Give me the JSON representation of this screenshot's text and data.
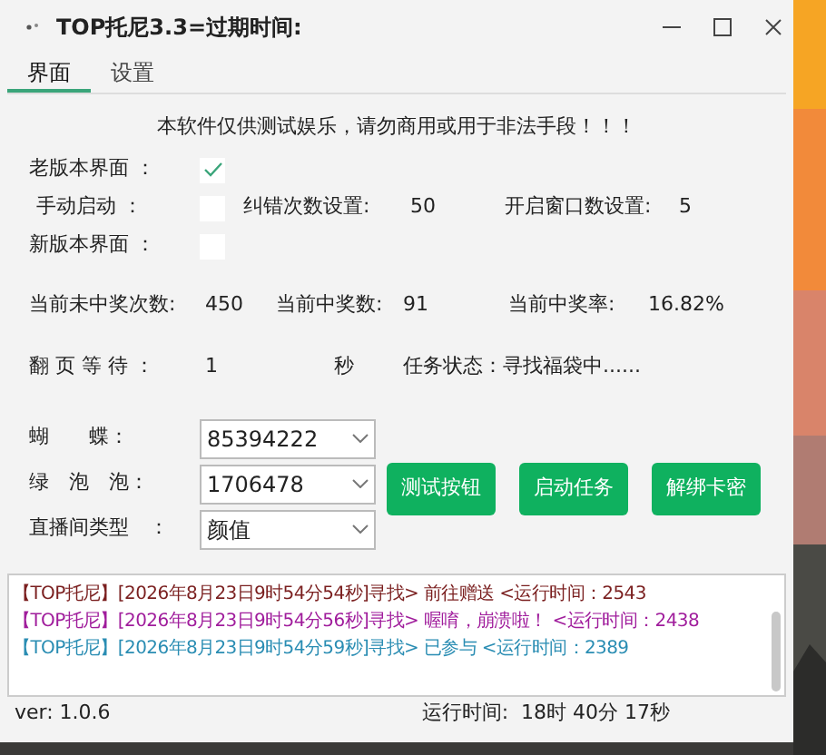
{
  "window": {
    "title": "TOP托尼3.3=过期时间:"
  },
  "tabs": [
    {
      "label": "界面",
      "selected": true
    },
    {
      "label": "设置",
      "selected": false
    }
  ],
  "notice": "本软件仅供测试娱乐，请勿商用或用于非法手段！！！",
  "old_ui": {
    "label": "老版本界面 ：",
    "checked": true
  },
  "manual_start": {
    "label": "手动启动 ：",
    "checked": false
  },
  "retry_count": {
    "label": "纠错次数设置:",
    "value": "50"
  },
  "window_count": {
    "label": "开启窗口数设置:",
    "value": "5"
  },
  "new_ui": {
    "label": "新版本界面 ：",
    "checked": false
  },
  "stats": [
    {
      "label": "当前未中奖次数:",
      "value": "450"
    },
    {
      "label": "当前中奖数:",
      "value": "91"
    },
    {
      "label": "当前中奖率:",
      "value": "16.82%"
    }
  ],
  "page_wait": {
    "label": "翻 页 等 待 ：",
    "value": "1",
    "unit": "秒"
  },
  "task_status": "任务状态：寻找福袋中......",
  "dropdowns": [
    {
      "label": "蝴　　蝶：",
      "value": "85394222"
    },
    {
      "label": "绿　泡　泡：",
      "value": "1706478"
    },
    {
      "label": "直播间类型　：",
      "value": "颜值"
    }
  ],
  "buttons": [
    "测试按钮",
    "启动任务",
    "解绑卡密"
  ],
  "log": [
    {
      "text": "【TOP托尼】[2026年8月23日9时54分54秒]寻找> 前往赠送 <运行时间：2543",
      "color": "#7a1f1f"
    },
    {
      "text": "【TOP托尼】[2026年8月23日9时54分56秒]寻找> 喔唷，崩溃啦！ <运行时间：2438",
      "color": "#a01d9c"
    },
    {
      "text": "【TOP托尼】[2026年8月23日9时54分59秒]寻找> 已参与 <运行时间：2389",
      "color": "#2a8db3"
    }
  ],
  "status_bar": {
    "version": "ver: 1.0.6",
    "runtime": "运行时间:  18时 40分 17秒"
  }
}
